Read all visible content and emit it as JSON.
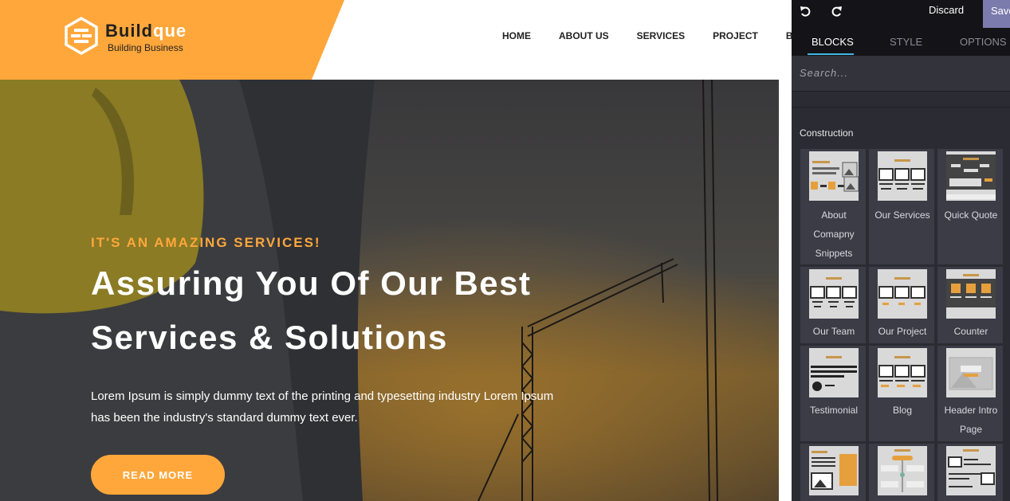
{
  "site": {
    "brand_part1": "Build",
    "brand_part2": "que",
    "tagline": "Building Business",
    "nav": [
      "HOME",
      "ABOUT US",
      "SERVICES",
      "PROJECT",
      "BO"
    ]
  },
  "hero": {
    "subtitle": "IT'S AN AMAZING SERVICES!",
    "title_line1": "Assuring You Of Our Best",
    "title_line2": "Services & Solutions",
    "text_line1": "Lorem Ipsum is simply dummy text of the printing and typesetting industry Lorem Ipsum",
    "text_line2": "has been the industry's standard dummy text ever.",
    "button": "READ MORE"
  },
  "editor": {
    "discard": "Discard",
    "save": "Save",
    "tabs": [
      "BLOCKS",
      "STYLE",
      "OPTIONS"
    ],
    "active_tab": "BLOCKS",
    "search_placeholder": "Search...",
    "section_title": "Construction",
    "snippets": [
      {
        "label": "About Comapny Snippets",
        "icon": "about-company-thumb"
      },
      {
        "label": "Our Services",
        "icon": "services-thumb"
      },
      {
        "label": "Quick Quote",
        "icon": "quick-quote-thumb"
      },
      {
        "label": "Our Team",
        "icon": "team-thumb"
      },
      {
        "label": "Our Project",
        "icon": "project-thumb"
      },
      {
        "label": "Counter",
        "icon": "counter-thumb"
      },
      {
        "label": "Testimonial",
        "icon": "testimonial-thumb"
      },
      {
        "label": "Blog",
        "icon": "blog-thumb"
      },
      {
        "label": "Header Intro Page",
        "icon": "header-intro-thumb"
      },
      {
        "label": "",
        "icon": "text-image-thumb"
      },
      {
        "label": "",
        "icon": "timeline-thumb"
      },
      {
        "label": "",
        "icon": "list-image-thumb"
      }
    ]
  },
  "colors": {
    "accent": "#ffa73b",
    "editor_bg": "#2b2b33",
    "editor_dark": "#141418",
    "tab_underline": "#3db7e4",
    "save_bg": "#7c7bad"
  }
}
